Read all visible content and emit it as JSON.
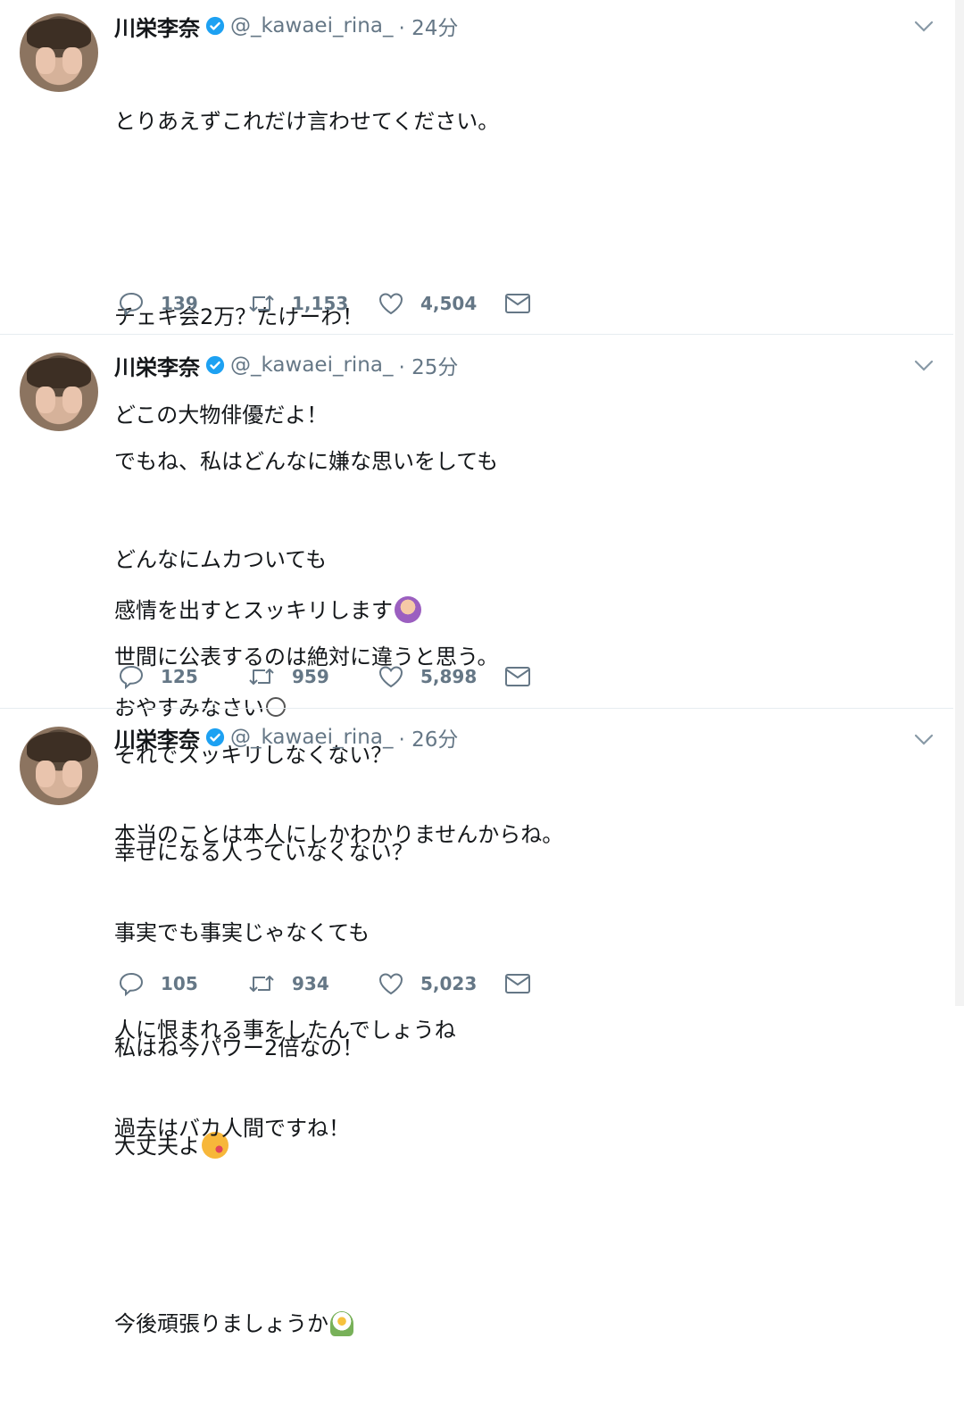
{
  "tweets": [
    {
      "name": "川栄李奈",
      "handle": "@_kawaei_rina_",
      "time": "· 24分",
      "lines": [
        "とりあえずこれだけ言わせてください。",
        "",
        "チェキ会2万？たけーわ！",
        "どこの大物俳優だよ！",
        "",
        "感情を出すとスッキリします",
        "おやすみなさい"
      ],
      "emoji_after_line": {
        "5": "person-gesturing-no",
        "6": "sleepy-face"
      },
      "replies": "139",
      "retweets": "1,153",
      "likes": "4,504"
    },
    {
      "name": "川栄李奈",
      "handle": "@_kawaei_rina_",
      "time": "· 25分",
      "lines": [
        "でもね、私はどんなに嫌な思いをしても",
        "どんなにムカついても",
        "世間に公表するのは絶対に違うと思う。",
        "それでスッキリしなくない？",
        "幸せになる人っていなくない？",
        "",
        "私はね今パワー2倍なの！",
        "大丈夫よ"
      ],
      "emoji_after_line": {
        "7": "kissing-face"
      },
      "replies": "125",
      "retweets": "959",
      "likes": "5,898"
    },
    {
      "name": "川栄李奈",
      "handle": "@_kawaei_rina_",
      "time": "· 26分",
      "lines": [
        "本当のことは本人にしかわかりませんからね。",
        "事実でも事実じゃなくても",
        "人に恨まれる事をしたんでしょうね",
        "過去はバカ人間ですね！",
        "",
        "今後頑張りましょうか"
      ],
      "emoji_after_line": {
        "5": "blossom"
      },
      "replies": "105",
      "retweets": "934",
      "likes": "5,023"
    }
  ],
  "colors": {
    "text": "#14171a",
    "secondary": "#657786",
    "verified": "#1da1f2",
    "divider": "#e6ecf0"
  }
}
